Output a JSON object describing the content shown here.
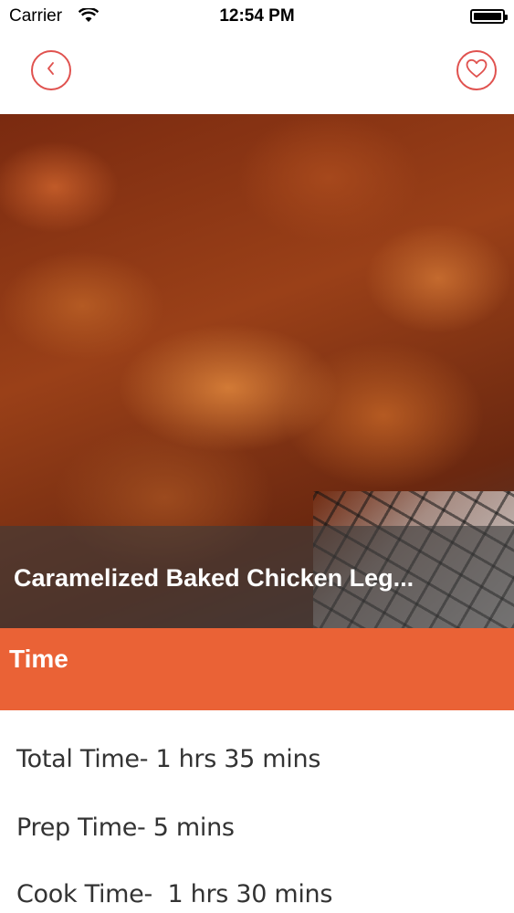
{
  "status_bar": {
    "carrier": "Carrier",
    "time": "12:54 PM"
  },
  "nav": {
    "back_icon": "chevron-left-icon",
    "favorite_icon": "heart-icon",
    "accent_color": "#e0524f"
  },
  "hero": {
    "title": "Caramelized Baked Chicken Leg..."
  },
  "section": {
    "title": "Time",
    "color": "#ea6236"
  },
  "times": {
    "total": "Total Time- 1 hrs 35 mins",
    "prep": "Prep Time- 5 mins",
    "cook": "Cook Time-  1 hrs 30 mins"
  }
}
